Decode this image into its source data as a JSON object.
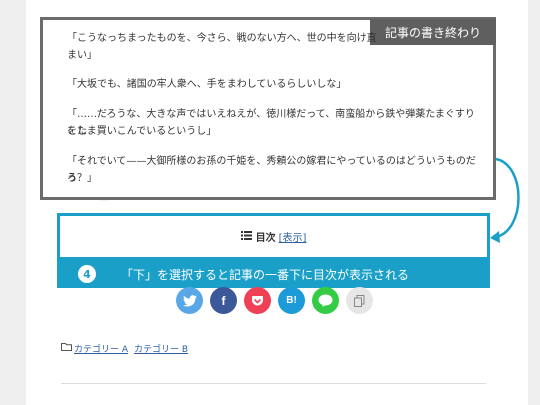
{
  "annotation": {
    "label": "記事の書き終わり",
    "step_number": "4",
    "step_text": "「下」を選択すると記事の一番下に目次が表示される"
  },
  "article": {
    "paragraphs": [
      "「こうなっちまったものを、今さら、戦のない方へ、世の中を向け直",
      "まい」",
      "「大坂でも、諸国の牢人衆へ、手をまわしているらしいしな」",
      "「……だろうな、大きな声ではいえねえが、徳川様だって、南蛮船から鉄や弾薬たまぐすりをし",
      "こたま買いこんでいるというし」",
      "「それでいて——大御所様のお孫の千姫を、秀頼公の嫁君にやっているのはどういうものだろ",
      "う？」"
    ]
  },
  "toc": {
    "title": "目次",
    "toggle": "[表示]"
  },
  "share": {
    "buttons": [
      {
        "name": "twitter",
        "icon": "twitter-icon",
        "label": "",
        "color": "#5aa7e8"
      },
      {
        "name": "facebook",
        "icon": "facebook-icon",
        "label": "f",
        "color": "#3b5998"
      },
      {
        "name": "pocket",
        "icon": "pocket-icon",
        "label": "",
        "color": "#ef4056"
      },
      {
        "name": "hatena",
        "icon": "hatena-bookmark-icon",
        "label": "B!",
        "color": "#1c9bd8"
      },
      {
        "name": "line",
        "icon": "line-icon",
        "label": "",
        "color": "#33cc44"
      },
      {
        "name": "copy",
        "icon": "copy-icon",
        "label": "",
        "color": "#e6e6e6"
      }
    ]
  },
  "categories": [
    "カテゴリー A",
    "カテゴリー B"
  ],
  "colors": {
    "accent": "#1aa0c8",
    "frame": "#6b6b6b",
    "link": "#2b5f9e"
  }
}
